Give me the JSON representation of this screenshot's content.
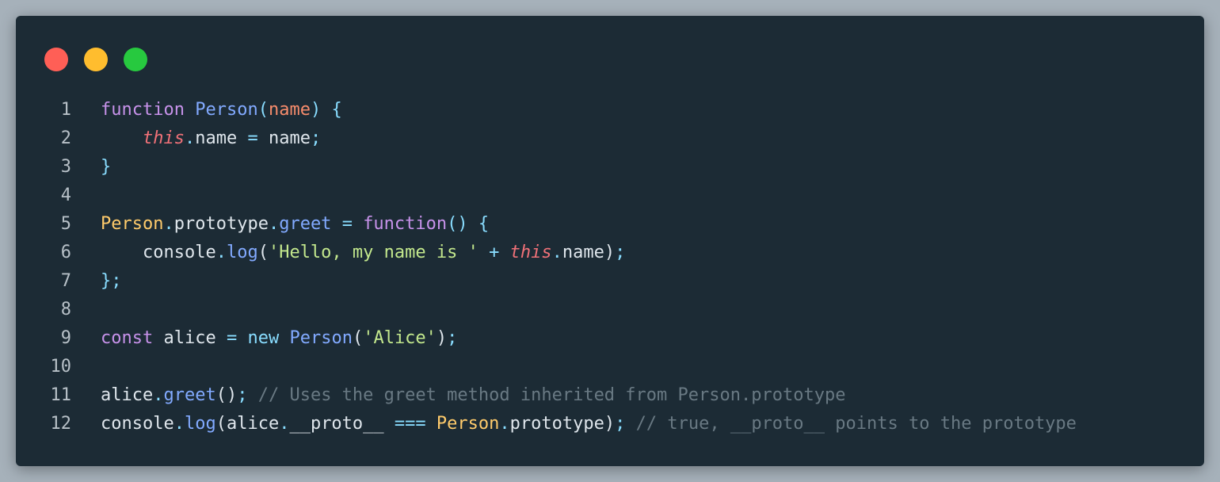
{
  "window": {
    "controls": {
      "close_color": "#ff5f56",
      "minimize_color": "#ffbd2e",
      "maximize_color": "#27c93f"
    },
    "background_color": "#1c2b35"
  },
  "colors": {
    "keyword": "#c792ea",
    "function_name": "#82aaff",
    "param": "#f78c6c",
    "this": "#f07178",
    "punct": "#89ddff",
    "plain": "#dfe6ec",
    "class": "#ffcb6b",
    "property": "#82aaff",
    "string": "#c3e88d",
    "comment": "#697983",
    "new": "#89ddff"
  },
  "code": {
    "lines": [
      {
        "number": "1",
        "tokens": [
          {
            "t": "function",
            "c": "keyword"
          },
          {
            "t": " ",
            "c": "plain"
          },
          {
            "t": "Person",
            "c": "function_name"
          },
          {
            "t": "(",
            "c": "punct"
          },
          {
            "t": "name",
            "c": "param"
          },
          {
            "t": ")",
            "c": "punct"
          },
          {
            "t": " ",
            "c": "plain"
          },
          {
            "t": "{",
            "c": "punct"
          }
        ]
      },
      {
        "number": "2",
        "tokens": [
          {
            "t": "    ",
            "c": "plain"
          },
          {
            "t": "this",
            "c": "this",
            "italic": true
          },
          {
            "t": ".",
            "c": "punct"
          },
          {
            "t": "name",
            "c": "plain"
          },
          {
            "t": " ",
            "c": "plain"
          },
          {
            "t": "=",
            "c": "punct"
          },
          {
            "t": " ",
            "c": "plain"
          },
          {
            "t": "name",
            "c": "plain"
          },
          {
            "t": ";",
            "c": "punct"
          }
        ]
      },
      {
        "number": "3",
        "tokens": [
          {
            "t": "}",
            "c": "punct"
          }
        ]
      },
      {
        "number": "4",
        "tokens": []
      },
      {
        "number": "5",
        "tokens": [
          {
            "t": "Person",
            "c": "class"
          },
          {
            "t": ".",
            "c": "punct"
          },
          {
            "t": "prototype",
            "c": "plain"
          },
          {
            "t": ".",
            "c": "punct"
          },
          {
            "t": "greet",
            "c": "property"
          },
          {
            "t": " ",
            "c": "plain"
          },
          {
            "t": "=",
            "c": "punct"
          },
          {
            "t": " ",
            "c": "plain"
          },
          {
            "t": "function",
            "c": "keyword"
          },
          {
            "t": "()",
            "c": "punct"
          },
          {
            "t": " ",
            "c": "plain"
          },
          {
            "t": "{",
            "c": "punct"
          }
        ]
      },
      {
        "number": "6",
        "tokens": [
          {
            "t": "    ",
            "c": "plain"
          },
          {
            "t": "console",
            "c": "plain"
          },
          {
            "t": ".",
            "c": "punct"
          },
          {
            "t": "log",
            "c": "property"
          },
          {
            "t": "(",
            "c": "plain"
          },
          {
            "t": "'Hello, my name is '",
            "c": "string"
          },
          {
            "t": " ",
            "c": "plain"
          },
          {
            "t": "+",
            "c": "punct"
          },
          {
            "t": " ",
            "c": "plain"
          },
          {
            "t": "this",
            "c": "this",
            "italic": true
          },
          {
            "t": ".",
            "c": "punct"
          },
          {
            "t": "name",
            "c": "plain"
          },
          {
            "t": ")",
            "c": "plain"
          },
          {
            "t": ";",
            "c": "punct"
          }
        ]
      },
      {
        "number": "7",
        "tokens": [
          {
            "t": "};",
            "c": "punct"
          }
        ]
      },
      {
        "number": "8",
        "tokens": []
      },
      {
        "number": "9",
        "tokens": [
          {
            "t": "const",
            "c": "keyword"
          },
          {
            "t": " ",
            "c": "plain"
          },
          {
            "t": "alice",
            "c": "plain"
          },
          {
            "t": " ",
            "c": "plain"
          },
          {
            "t": "=",
            "c": "punct"
          },
          {
            "t": " ",
            "c": "plain"
          },
          {
            "t": "new",
            "c": "new"
          },
          {
            "t": " ",
            "c": "plain"
          },
          {
            "t": "Person",
            "c": "function_name"
          },
          {
            "t": "(",
            "c": "plain"
          },
          {
            "t": "'Alice'",
            "c": "string"
          },
          {
            "t": ")",
            "c": "plain"
          },
          {
            "t": ";",
            "c": "punct"
          }
        ]
      },
      {
        "number": "10",
        "tokens": []
      },
      {
        "number": "11",
        "tokens": [
          {
            "t": "alice",
            "c": "plain"
          },
          {
            "t": ".",
            "c": "punct"
          },
          {
            "t": "greet",
            "c": "property"
          },
          {
            "t": "()",
            "c": "plain"
          },
          {
            "t": ";",
            "c": "punct"
          },
          {
            "t": " ",
            "c": "plain"
          },
          {
            "t": "// Uses the greet method inherited from Person.prototype",
            "c": "comment"
          }
        ]
      },
      {
        "number": "12",
        "tokens": [
          {
            "t": "console",
            "c": "plain"
          },
          {
            "t": ".",
            "c": "punct"
          },
          {
            "t": "log",
            "c": "property"
          },
          {
            "t": "(",
            "c": "plain"
          },
          {
            "t": "alice",
            "c": "plain"
          },
          {
            "t": ".",
            "c": "punct"
          },
          {
            "t": "__proto__",
            "c": "plain"
          },
          {
            "t": " ",
            "c": "plain"
          },
          {
            "t": "===",
            "c": "punct"
          },
          {
            "t": " ",
            "c": "plain"
          },
          {
            "t": "Person",
            "c": "class"
          },
          {
            "t": ".",
            "c": "punct"
          },
          {
            "t": "prototype",
            "c": "plain"
          },
          {
            "t": ")",
            "c": "plain"
          },
          {
            "t": ";",
            "c": "punct"
          },
          {
            "t": " ",
            "c": "plain"
          },
          {
            "t": "// true, __proto__ points to the prototype",
            "c": "comment"
          }
        ]
      }
    ]
  }
}
